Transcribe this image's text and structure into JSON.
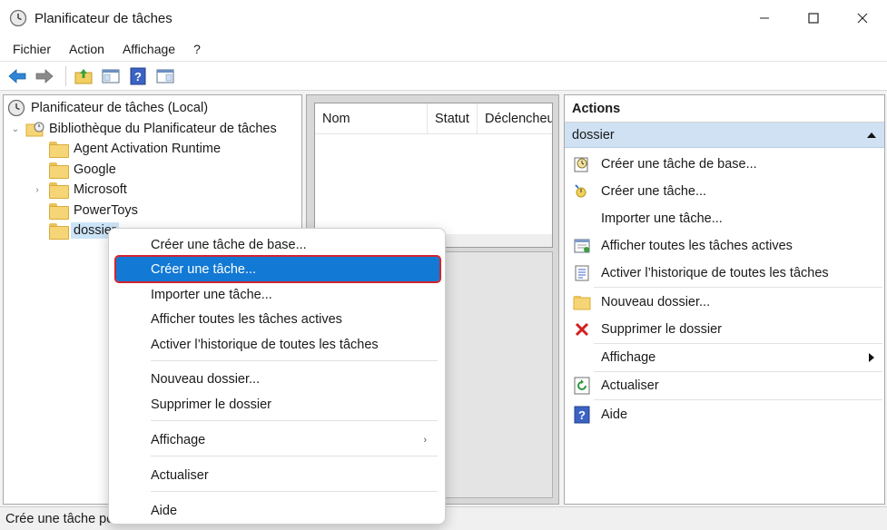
{
  "window": {
    "title": "Planificateur de tâches",
    "icon": "clock-icon"
  },
  "menubar": {
    "items": [
      "Fichier",
      "Action",
      "Affichage",
      "?"
    ]
  },
  "toolbar": {
    "buttons": [
      "back-arrow-icon",
      "forward-arrow-icon",
      "up-folder-icon",
      "show-hide-tree-icon",
      "help-icon",
      "show-hide-actions-icon"
    ]
  },
  "tree": {
    "root": "Planificateur de tâches (Local)",
    "library": "Bibliothèque du Planificateur de tâches",
    "folders": [
      "Agent Activation Runtime",
      "Google",
      "Microsoft",
      "PowerToys",
      "dossier"
    ],
    "selected": "dossier"
  },
  "list": {
    "columns": [
      "Nom",
      "Statut",
      "Déclencheu"
    ]
  },
  "actions": {
    "header": "Actions",
    "section": "dossier",
    "items": [
      {
        "label": "Créer une tâche de base...",
        "icon": "basic-task-icon"
      },
      {
        "label": "Créer une tâche...",
        "icon": "task-icon"
      },
      {
        "label": "Importer une tâche...",
        "icon": ""
      },
      {
        "label": "Afficher toutes les tâches actives",
        "icon": "active-tasks-icon"
      },
      {
        "label": "Activer l’historique de toutes les tâches",
        "icon": "history-icon"
      },
      {
        "label": "Nouveau dossier...",
        "icon": "folder-icon"
      },
      {
        "label": "Supprimer le dossier",
        "icon": "delete-x-icon"
      },
      {
        "label": "Affichage",
        "icon": ""
      },
      {
        "label": "Actualiser",
        "icon": "refresh-icon"
      },
      {
        "label": "Aide",
        "icon": "help-icon"
      }
    ]
  },
  "context_menu": {
    "items": [
      "Créer une tâche de base...",
      "Créer une tâche...",
      "Importer une tâche...",
      "Afficher toutes les tâches actives",
      "Activer l’historique de toutes les tâches",
      "Nouveau dossier...",
      "Supprimer le dossier",
      "Affichage",
      "Actualiser",
      "Aide"
    ],
    "highlighted": "Créer une tâche...",
    "submenu_arrow": "›"
  },
  "statusbar": {
    "text": "Crée une tâche pe"
  },
  "colors": {
    "highlight": "#1279d4",
    "highlight_outline": "#d3232f",
    "actions_section_bg": "#cfe1f3",
    "tree_selected_bg": "#cce4f7"
  }
}
